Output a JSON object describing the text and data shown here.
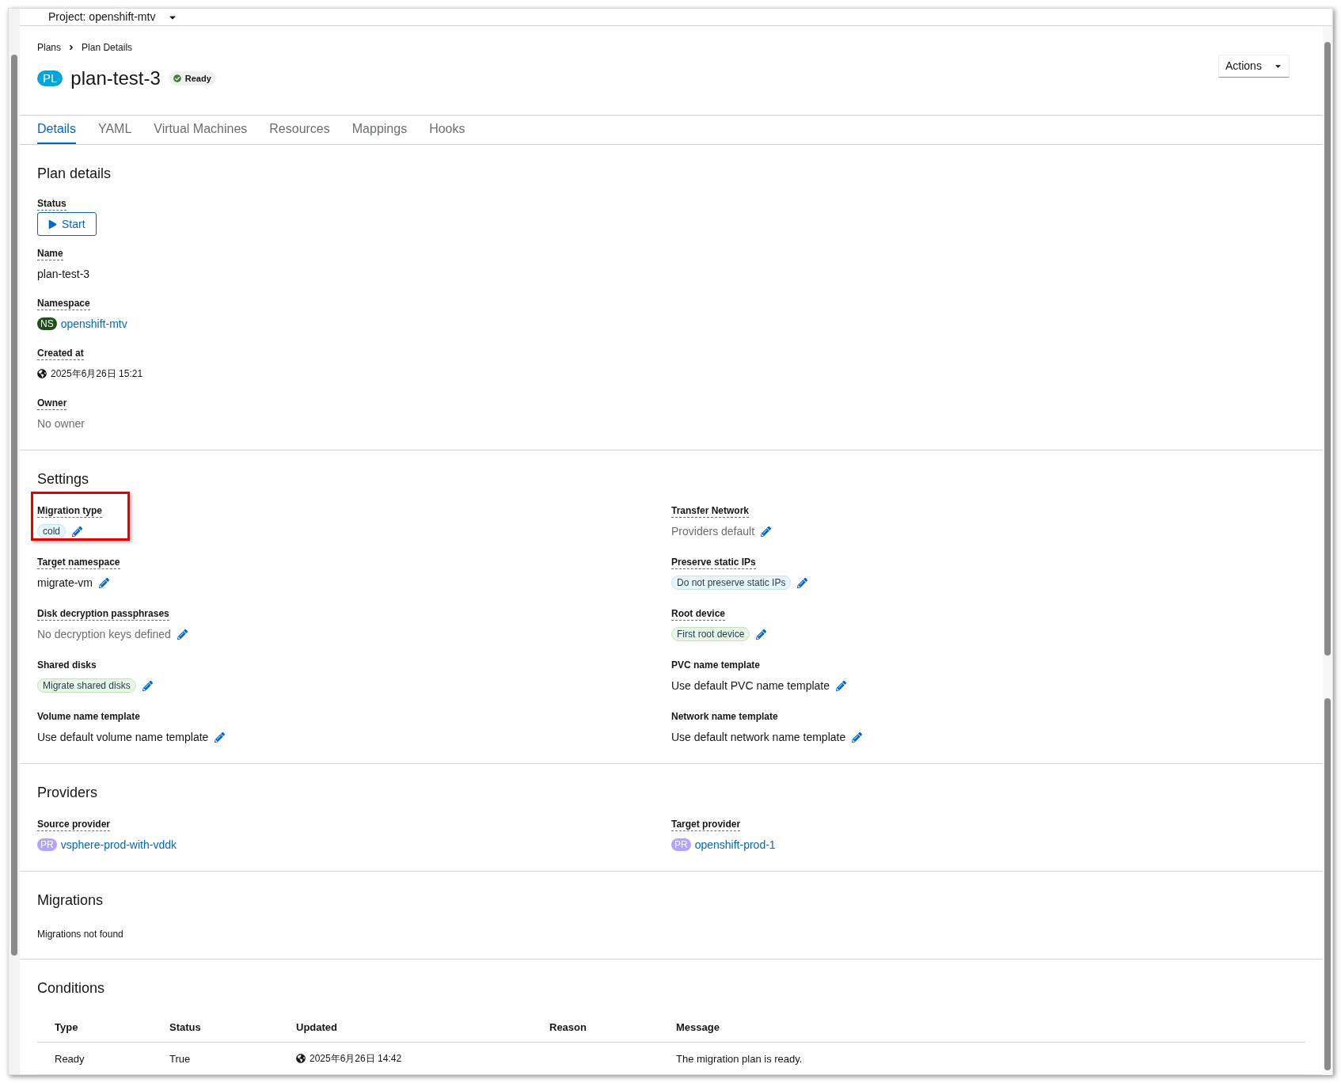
{
  "project": {
    "label": "Project: openshift-mtv"
  },
  "breadcrumbs": [
    "Plans",
    "Plan Details"
  ],
  "title": {
    "badge": "PL",
    "name": "plan-test-3",
    "status": "Ready"
  },
  "actions": {
    "label": "Actions"
  },
  "tabs": [
    {
      "label": "Details",
      "selected": true
    },
    {
      "label": "YAML",
      "selected": false
    },
    {
      "label": "Virtual Machines",
      "selected": false
    },
    {
      "label": "Resources",
      "selected": false
    },
    {
      "label": "Mappings",
      "selected": false
    },
    {
      "label": "Hooks",
      "selected": false
    }
  ],
  "plan_details": {
    "heading": "Plan details",
    "fields": [
      {
        "label": "Status",
        "has_help": true,
        "kind": "button",
        "value": "Start"
      },
      {
        "label": "Name",
        "has_help": true,
        "kind": "text",
        "value": "plan-test-3"
      },
      {
        "label": "Namespace",
        "has_help": true,
        "kind": "link",
        "badge": {
          "text": "NS",
          "color": "#1e4f18"
        },
        "value": "openshift-mtv"
      },
      {
        "label": "Created at",
        "has_help": true,
        "kind": "timestamp",
        "value": "2025年6月26日 15:21"
      },
      {
        "label": "Owner",
        "has_help": true,
        "kind": "muted",
        "value": "No owner"
      }
    ]
  },
  "settings": {
    "heading": "Settings",
    "left": [
      {
        "label": "Migration type",
        "has_help": true,
        "kind": "chip",
        "color": "#bee1f4",
        "value": "cold",
        "editable": true,
        "highlighted": true
      },
      {
        "label": "Target namespace",
        "has_help": true,
        "kind": "text",
        "value": "migrate-vm",
        "editable": true,
        "highlighted": false
      },
      {
        "label": "Disk decryption passphrases",
        "has_help": true,
        "kind": "muted",
        "value": "No decryption keys defined",
        "editable": true,
        "highlighted": false
      },
      {
        "label": "Shared disks",
        "has_help": false,
        "kind": "chip",
        "color": "#bde5b8",
        "value": "Migrate shared disks",
        "editable": true,
        "highlighted": false
      },
      {
        "label": "Volume name template",
        "has_help": false,
        "kind": "text",
        "value": "Use default volume name template",
        "editable": true,
        "highlighted": false
      }
    ],
    "right": [
      {
        "label": "Transfer Network",
        "has_help": true,
        "kind": "muted",
        "value": "Providers default",
        "editable": true,
        "highlighted": false
      },
      {
        "label": "Preserve static IPs",
        "has_help": true,
        "kind": "chip",
        "color": "#bee1f4",
        "value": "Do not preserve static IPs",
        "editable": true,
        "highlighted": false
      },
      {
        "label": "Root device",
        "has_help": true,
        "kind": "chip",
        "color": "#bde5b8",
        "value": "First root device",
        "editable": true,
        "highlighted": false
      },
      {
        "label": "PVC name template",
        "has_help": false,
        "kind": "text",
        "value": "Use default PVC name template",
        "editable": true,
        "highlighted": false
      },
      {
        "label": "Network name template",
        "has_help": false,
        "kind": "text",
        "value": "Use default network name template",
        "editable": true,
        "highlighted": false
      }
    ]
  },
  "providers": {
    "heading": "Providers",
    "left": [
      {
        "label": "Source provider",
        "has_help": true,
        "kind": "link",
        "badge": {
          "text": "PR",
          "color": "#b2a3ff"
        },
        "value": "vsphere-prod-with-vddk"
      }
    ],
    "right": [
      {
        "label": "Target provider",
        "has_help": true,
        "kind": "link",
        "badge": {
          "text": "PR",
          "color": "#b2a3ff"
        },
        "value": "openshift-prod-1"
      }
    ]
  },
  "migrations": {
    "heading": "Migrations",
    "message": "Migrations not found"
  },
  "conditions": {
    "heading": "Conditions",
    "columns": [
      "Type",
      "Status",
      "Updated",
      "Reason",
      "Message"
    ],
    "rows": [
      [
        "Ready",
        "True",
        "2025年6月26日 14:42",
        "",
        "The migration plan is ready."
      ]
    ]
  }
}
